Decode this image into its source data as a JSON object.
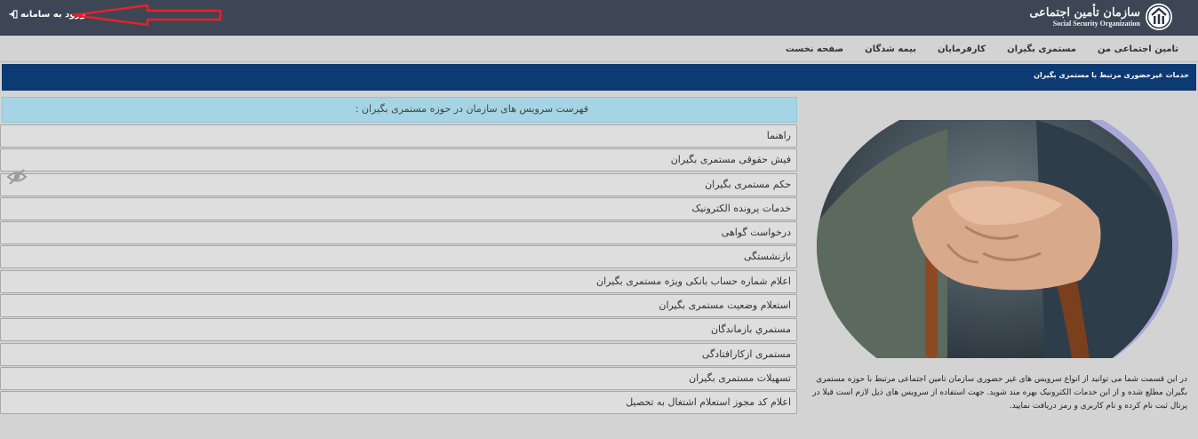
{
  "header": {
    "login_label": "ورود به سامانه",
    "logo_title": "سازمان تأمین اجتماعی",
    "logo_subtitle": "Social Security Organization"
  },
  "nav": [
    "صفحه نخست",
    "بیمه شدگان",
    "کارفرمایان",
    "مستمری بگیران",
    "تامین اجتماعی من"
  ],
  "banner": {
    "title": "خدمات غیرحضوری مرتبط با مستمری بگیران"
  },
  "services": {
    "heading": "فهرست سرویس های سازمان در حوزه مستمری بگیران :",
    "items": [
      "راهنما",
      "فیش حقوقی مستمری بگیران",
      "حکم مستمری بگیران",
      "خدمات پرونده الکترونیک",
      "درخواست گواهی",
      "بازنشستگی",
      "اعلام شماره حساب بانکی ویژه مستمری بگیران",
      "استعلام وضعیت مستمری بگیران",
      "مستمري بازماندگان",
      "مستمری ازکارافتادگی",
      "تسهیلات مستمری بگیران",
      "اعلام کد مجوز استعلام اشتغال به تحصیل"
    ]
  },
  "description": "در این قسمت شما می توانید از انواع سرویس های غیر حضوری سازمان تامین اجتماعی مرتبط با حوزه مستمری بگیران مطلع شده و از این خدمات الکترونیک بهره مند شوید. جهت استفاده از سرویس های ذیل لازم است قبلا در پرتال ثبت نام کرده و نام کاربری و رمز دریافت نمایید.",
  "icons": {
    "login": "sign-in-icon",
    "emblem": "ssl-emblem-icon",
    "eye": "eye-slash-icon",
    "annotation": "red-arrow-annotation"
  },
  "colors": {
    "header_bg": "#3c4655",
    "banner_bg": "#0d3a73",
    "services_header_bg": "#a5d4e4",
    "annotation_red": "#e8202a"
  }
}
